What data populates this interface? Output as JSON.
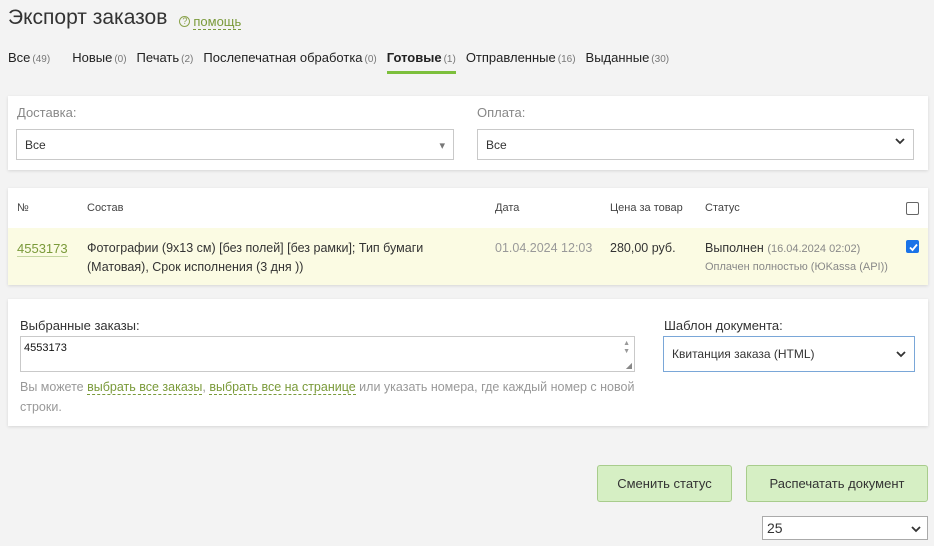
{
  "header": {
    "title": "Экспорт заказов",
    "help_icon": "?",
    "help": "помощь"
  },
  "tabs": [
    {
      "label": "Все",
      "count": "(49)"
    },
    {
      "label": "Новые",
      "count": "(0)"
    },
    {
      "label": "Печать",
      "count": "(2)"
    },
    {
      "label": "Послепечатная обработка",
      "count": "(0)"
    },
    {
      "label": "Готовые",
      "count": "(1)"
    },
    {
      "label": "Отправленные",
      "count": "(16)"
    },
    {
      "label": "Выданные",
      "count": "(30)"
    }
  ],
  "filters": {
    "delivery": {
      "label": "Доставка:",
      "value": "Все",
      "arrow": "▾"
    },
    "payment": {
      "label": "Оплата:",
      "value": "Все"
    }
  },
  "orders": {
    "headers": {
      "num": "№",
      "composition": "Состав",
      "date": "Дата",
      "price": "Цена за товар",
      "status": "Статус"
    },
    "rows": [
      {
        "num": "4553173",
        "composition": "Фотографии (9х13 см) [без полей] [без рамки]; Тип бумаги (Матовая), Срок исполнения (3 дня ))",
        "date": "01.04.2024 12:03",
        "price": "280,00 руб.",
        "status": "Выполнен",
        "status_date": "(16.04.2024 02:02)",
        "payment": "Оплачен полностью (ЮKassa (API))",
        "checked": true
      }
    ]
  },
  "export": {
    "selected_label": "Выбранные заказы:",
    "selected_value": "4553173",
    "scroll_up": "▲",
    "scroll_down": "▼",
    "resize_grip": "◢",
    "hint_prefix": "Вы можете ",
    "hint_link_all": "выбрать все заказы",
    "hint_comma": ", ",
    "hint_link_page": "выбрать все на странице",
    "hint_suffix": " или указать номера, где каждый номер с новой строки.",
    "template_label": "Шаблон документа:",
    "template_value": "Квитанция заказа (HTML)"
  },
  "actions": {
    "change_status": "Сменить статус",
    "print_document": "Распечатать документ"
  },
  "pagination": {
    "per_page": "25"
  },
  "colors": {
    "accent_green": "#7cbf3c",
    "link_green": "#7a9a3a",
    "button_bg": "#d6efc4",
    "row_highlight": "#fbfbe3",
    "checkbox_blue": "#1a73e8"
  }
}
